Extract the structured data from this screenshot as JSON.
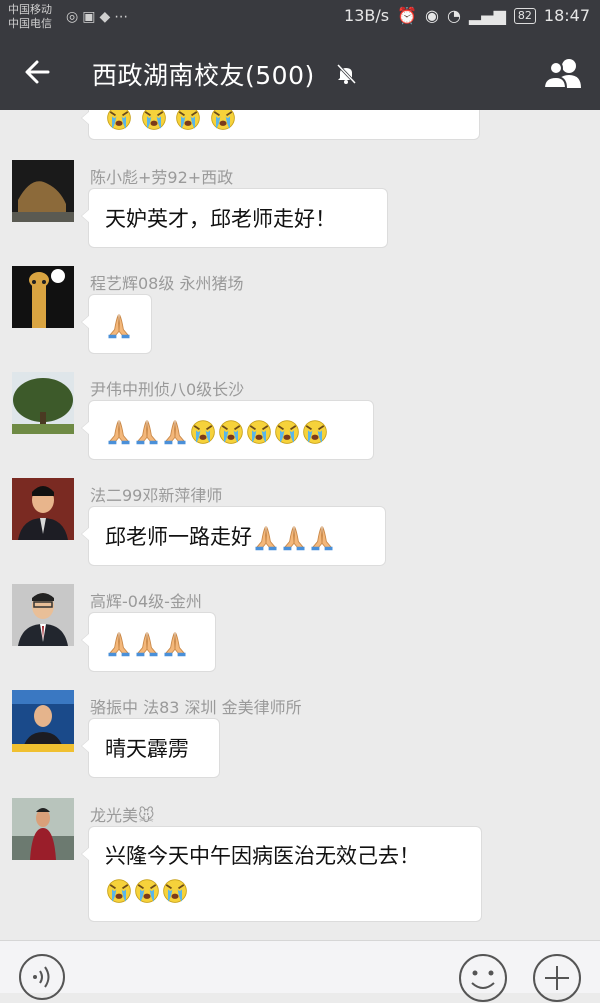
{
  "status_bar": {
    "carrier1": "中国移动",
    "carrier2": "中国电信",
    "speed": "13B/s",
    "battery": "82",
    "time": "18:47"
  },
  "header": {
    "title": "西政湖南校友(500)"
  },
  "messages": [
    {
      "sender": "陈小彪+劳92+西政",
      "text": "天妒英才，邱老师走好！"
    },
    {
      "sender": "程艺辉08级 永州猪场",
      "text": ""
    },
    {
      "sender": "尹伟中刑侦八0级长沙",
      "text": ""
    },
    {
      "sender": "法二99邓新萍律师",
      "text": "邱老师一路走好"
    },
    {
      "sender": "高辉-04级-金州",
      "text": ""
    },
    {
      "sender": "骆振中 法83 深圳 金美律师所",
      "text": "晴天霹雳"
    },
    {
      "sender": "龙光美",
      "text": "兴隆今天中午因病医治无效己去！"
    }
  ],
  "emoji_names": [
    "folded-hands",
    "crying-face",
    "mouse-face"
  ],
  "colors": {
    "topbar": "#393a3f",
    "chat_bg": "#ebebeb",
    "bubble": "#ffffff"
  }
}
